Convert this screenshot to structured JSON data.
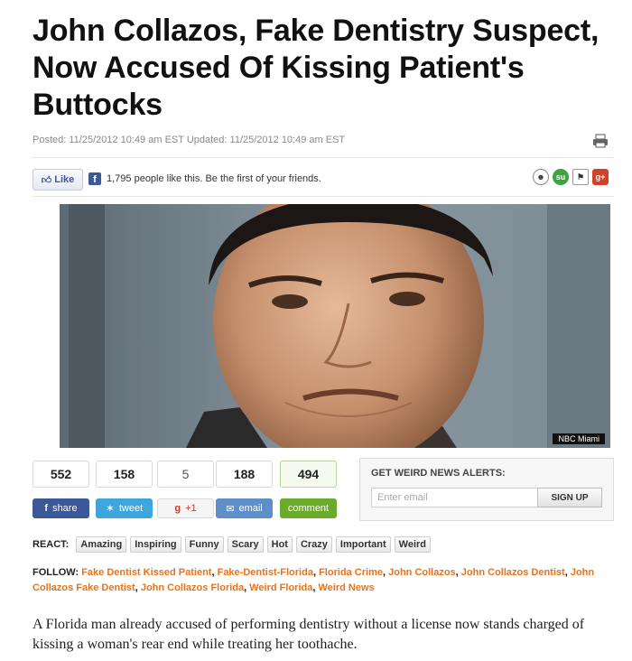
{
  "article": {
    "headline": "John Collazos, Fake Dentistry Suspect, Now Accused Of Kissing Patient's Buttocks",
    "meta": "Posted: 11/25/2012 10:49 am EST Updated: 11/25/2012 10:49 am EST",
    "photo_credit": "NBC Miami",
    "lede": "A Florida man already accused of performing dentistry without a license now stands charged of kissing a woman's rear end while treating her toothache."
  },
  "facebook": {
    "like_label": "Like",
    "like_text": "1,795 people like this. Be the first of your friends."
  },
  "social_icons": [
    "reddit-icon",
    "stumbleupon-icon",
    "flag-icon",
    "google-plus-icon"
  ],
  "share": {
    "facebook": {
      "count": "552",
      "label": "share"
    },
    "twitter": {
      "count": "158",
      "label": "tweet"
    },
    "google": {
      "count": "5",
      "label": "+1"
    },
    "email": {
      "count": "188",
      "label": "email"
    },
    "comment": {
      "count": "494",
      "label": "comment"
    }
  },
  "alerts": {
    "title": "GET WEIRD NEWS ALERTS:",
    "placeholder": "Enter email",
    "button": "SIGN UP"
  },
  "react": {
    "label": "REACT:",
    "buttons": [
      "Amazing",
      "Inspiring",
      "Funny",
      "Scary",
      "Hot",
      "Crazy",
      "Important",
      "Weird"
    ]
  },
  "follow": {
    "label": "FOLLOW:",
    "tags": [
      "Fake Dentist Kissed Patient",
      "Fake-Dentist-Florida",
      "Florida Crime",
      "John Collazos",
      "John Collazos Dentist",
      "John Collazos Fake Dentist",
      "John Collazos Florida",
      "Weird Florida",
      "Weird News"
    ]
  },
  "colors": {
    "facebook": "#3b5998",
    "twitter": "#3ea6dd",
    "google": "#c93b2b",
    "email": "#5f8fc9",
    "comment": "#6bab2c",
    "link_orange": "#e8731c"
  }
}
